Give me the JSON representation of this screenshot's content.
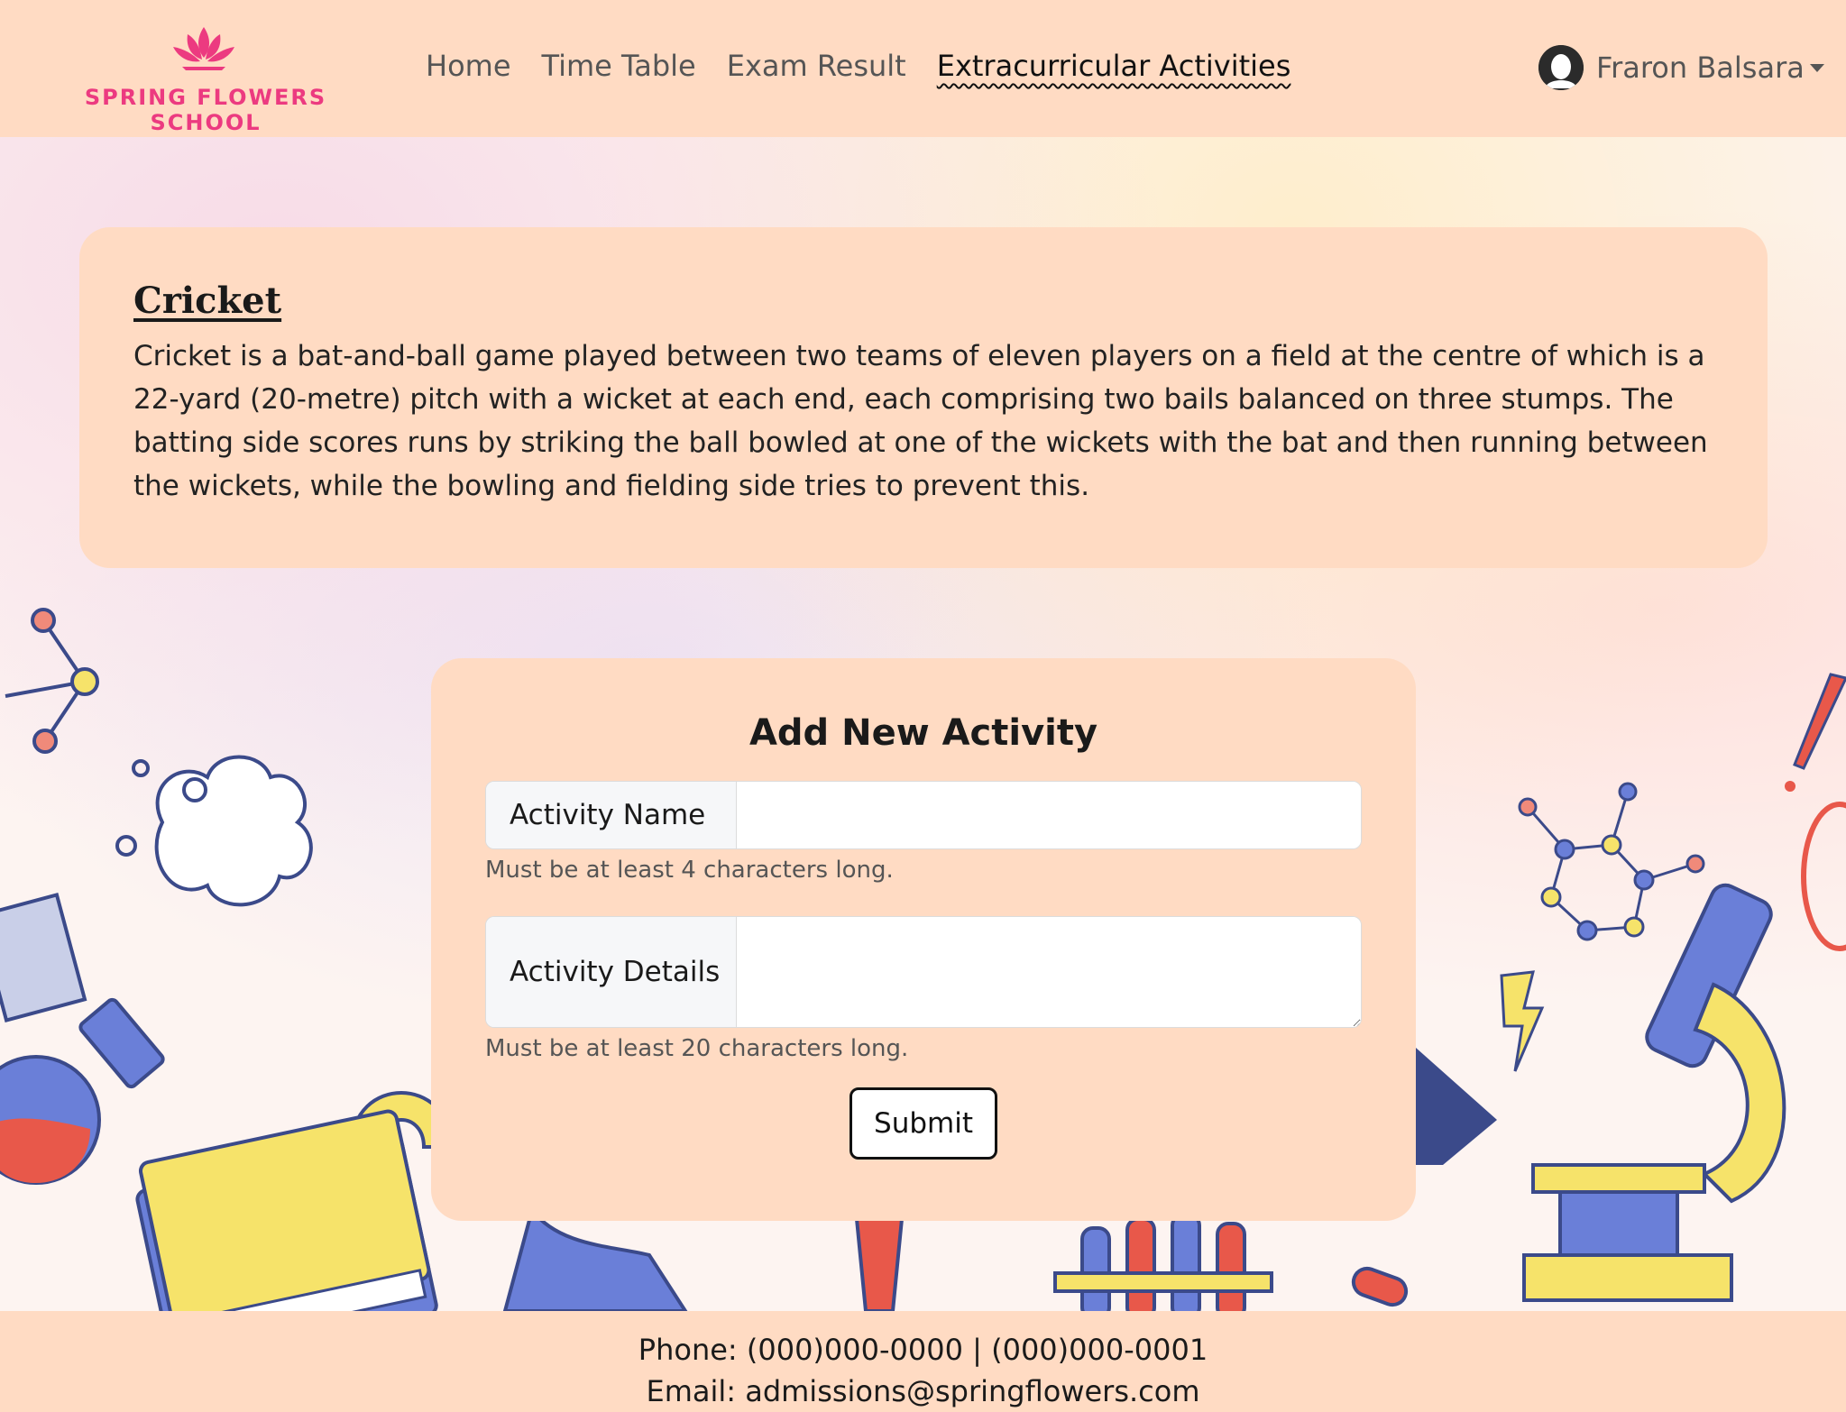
{
  "brand": {
    "name": "SPRING FLOWERS SCHOOL",
    "logo_icon": "lotus-flower-icon",
    "color": "#ec3a80"
  },
  "nav": {
    "items": [
      {
        "label": "Home",
        "active": false
      },
      {
        "label": "Time Table",
        "active": false
      },
      {
        "label": "Exam Result",
        "active": false
      },
      {
        "label": "Extracurricular Activities",
        "active": true
      }
    ]
  },
  "user": {
    "name": "Fraron Balsara",
    "avatar_icon": "user-avatar-icon",
    "dropdown_icon": "caret-down-icon"
  },
  "activity": {
    "title": "Cricket",
    "description": "Cricket is a bat-and-ball game played between two teams of eleven players on a field at the centre of which is a 22-yard (20-metre) pitch with a wicket at each end, each comprising two bails balanced on three stumps. The batting side scores runs by striking the ball bowled at one of the wickets with the bat and then running between the wickets, while the bowling and fielding side tries to prevent this."
  },
  "form": {
    "title": "Add New Activity",
    "name_label": "Activity Name",
    "name_value": "",
    "name_hint": "Must be at least 4 characters long.",
    "details_label": "Activity Details",
    "details_value": "",
    "details_hint": "Must be at least 20 characters long.",
    "submit_label": "Submit"
  },
  "footer": {
    "phone": "Phone: (000)000-0000 | (000)000-0001",
    "email": "Email: admissions@springflowers.com"
  },
  "colors": {
    "header_bg": "#ffdbc3",
    "card_bg": "#ffdbc3",
    "brand_pink": "#ec3a80"
  }
}
